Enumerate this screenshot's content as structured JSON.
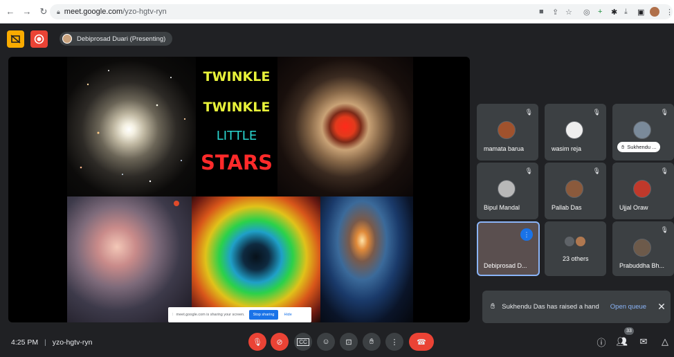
{
  "browser": {
    "url_host": "meet.google.com",
    "url_path": "/yzo-hgtv-ryn"
  },
  "header": {
    "presenter_label": "Debiprosad Duari (Presenting)"
  },
  "slide": {
    "line1": "TWINKLE",
    "line2": "TWINKLE",
    "line3": "LITTLE",
    "line4": "STARS",
    "colors": {
      "yellow": "#e8f23a",
      "cyan": "#2ad6d0",
      "red": "#ff2a2a"
    }
  },
  "share_bar": {
    "message": "meet.google.com is sharing your screen.",
    "stop_label": "Stop sharing",
    "hide_label": "Hide"
  },
  "participants": [
    {
      "name": "mamata barua"
    },
    {
      "name": "wasim reja"
    },
    {
      "name": "Sukhendu ..."
    },
    {
      "name": "Bipul Mandal"
    },
    {
      "name": "Pallab Das"
    },
    {
      "name": "Ujjal Oraw"
    },
    {
      "name": "Debiprosad D..."
    },
    {
      "name": "23 others"
    },
    {
      "name": "Prabuddha Bh..."
    }
  ],
  "notification": {
    "text": "Sukhendu Das has raised a hand",
    "action_label": "Open queue"
  },
  "footer": {
    "time": "4:25 PM",
    "separator": "|",
    "meeting_code": "yzo-hgtv-ryn",
    "people_count": "33"
  }
}
